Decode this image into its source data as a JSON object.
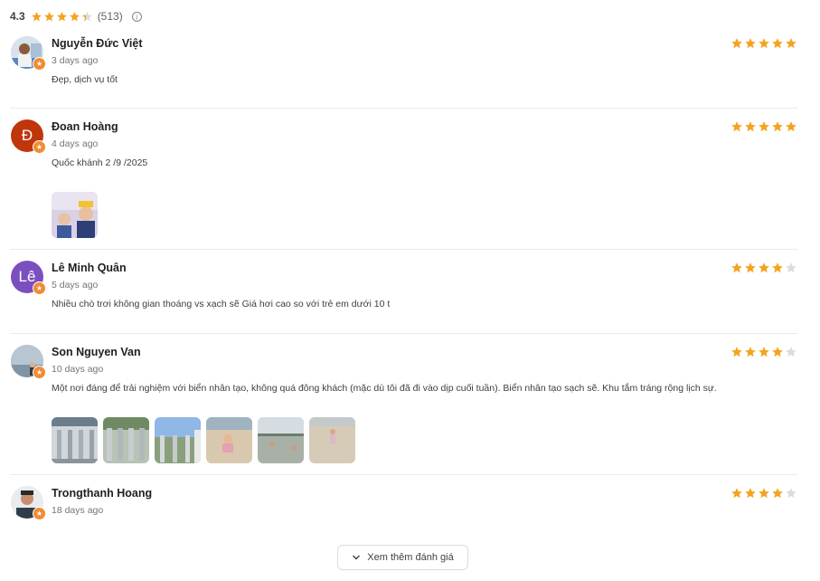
{
  "summary": {
    "rating": "4.3",
    "stars": [
      1,
      1,
      1,
      1,
      0.35
    ],
    "count": "(513)",
    "info_icon": "info-icon"
  },
  "colors": {
    "star_filled": "#f4a31f",
    "star_empty": "#dadce0",
    "badge": "#f28b31"
  },
  "reviews": [
    {
      "name": "Nguyễn Đức Việt",
      "date": "3 days ago",
      "text": "Đẹp, dịch vụ tốt",
      "rating": 5,
      "avatar_letter": "",
      "avatar_color": "#c9d6e3"
    },
    {
      "name": "Đoan Hoàng",
      "date": "4 days ago",
      "text": "Quốc khánh 2 /9 /2025",
      "rating": 5,
      "avatar_letter": "Đ",
      "avatar_color": "#c0360c"
    },
    {
      "name": "Lê Minh Quân",
      "date": "5 days ago",
      "text": "Nhiều chò trơi không gian thoáng vs xạch sẽ Giá hơi cao so với trẻ em dưới 10 t",
      "rating": 4,
      "avatar_letter": "Lê",
      "avatar_color": "#7b4fc0"
    },
    {
      "name": "Son Nguyen Van",
      "date": "10 days ago",
      "text": "Một nơi đáng để trải nghiệm với biển nhân tạo, không quá đông khách (mặc dù tôi đã đi vào dịp cuối tuần). Biển nhân tạo sạch sẽ. Khu tắm tráng rộng lịch sự.",
      "rating": 4,
      "avatar_letter": "",
      "avatar_color": "#8fa6b8"
    },
    {
      "name": "Trongthanh Hoang",
      "date": "18 days ago",
      "text": "",
      "rating": 4,
      "avatar_letter": "",
      "avatar_color": "#e8e8e8"
    }
  ],
  "more_button": {
    "label": "Xem thêm đánh giá"
  }
}
